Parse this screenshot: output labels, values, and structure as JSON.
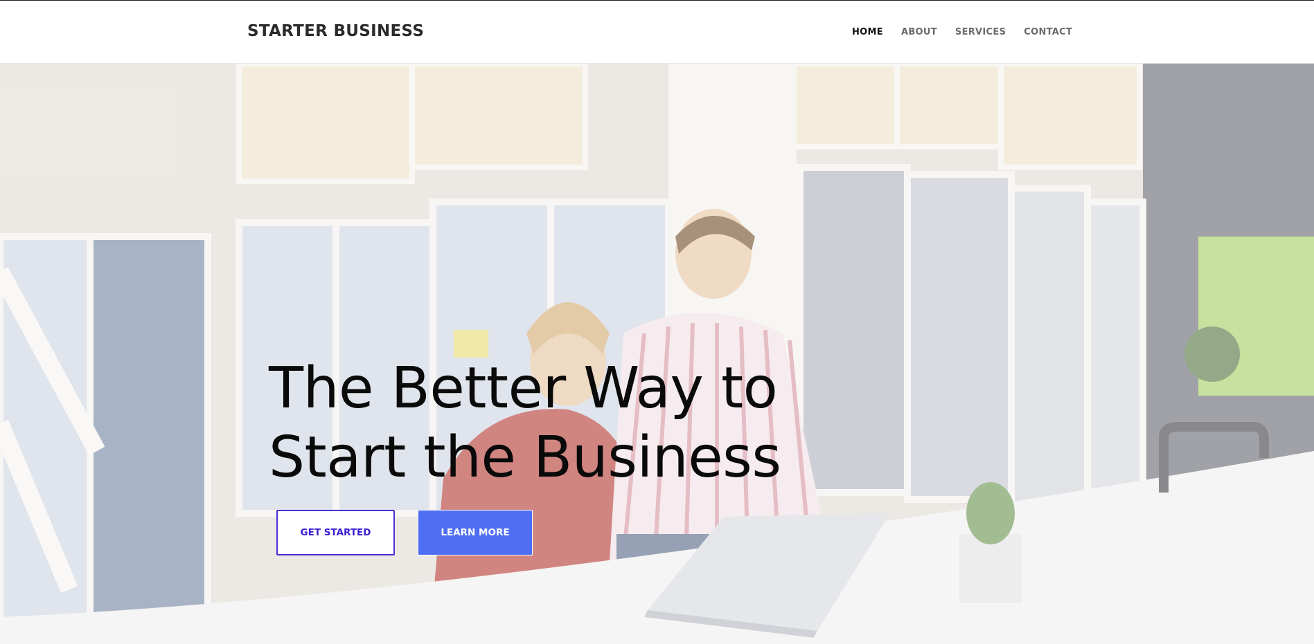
{
  "header": {
    "brand": "STARTER BUSINESS",
    "nav": [
      "HOME",
      "ABOUT",
      "SERVICES",
      "CONTACT"
    ],
    "active_nav": "HOME"
  },
  "hero": {
    "headline_line1": "The Better Way to",
    "headline_line2": "Start the Business",
    "primary_button": "GET STARTED",
    "secondary_button": "LEARN MORE",
    "background_image": "office-team-with-laptop-photo"
  },
  "colors": {
    "accent": "#4f6ef2",
    "primary_outline": "#4a2fd6",
    "text_dark": "#0a0a0a",
    "nav_muted": "#6b6b6b"
  }
}
